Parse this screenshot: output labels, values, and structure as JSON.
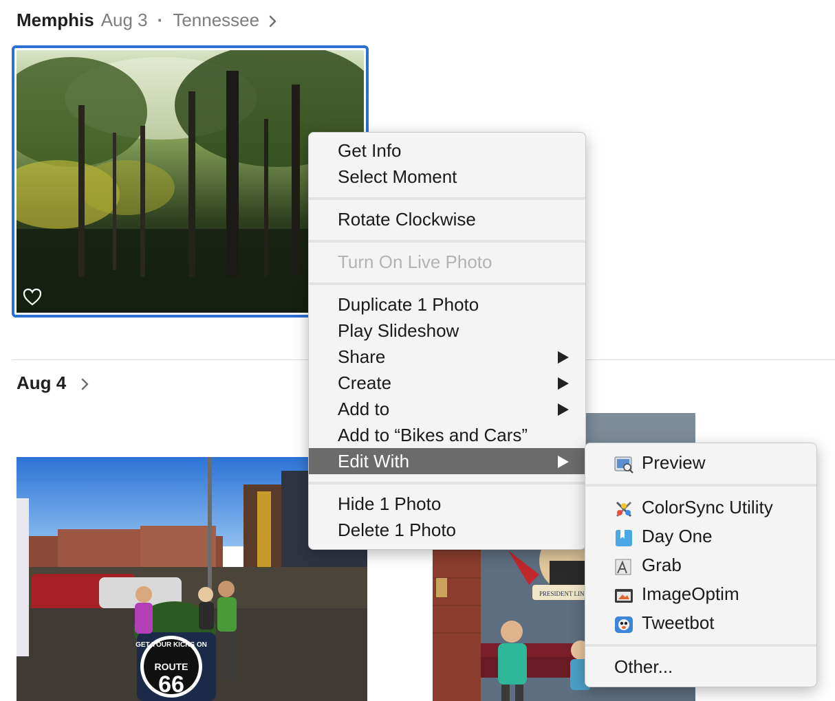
{
  "moment1": {
    "title": "Memphis",
    "date": "Aug 3",
    "separator": "·",
    "location": "Tennessee"
  },
  "moment2": {
    "date": "Aug 4"
  },
  "context_menu": {
    "items": [
      {
        "label": "Get Info"
      },
      {
        "label": "Select Moment"
      },
      {
        "label": "Rotate Clockwise"
      },
      {
        "label": "Turn On Live Photo",
        "disabled": true
      },
      {
        "label": "Duplicate 1 Photo"
      },
      {
        "label": "Play Slideshow"
      },
      {
        "label": "Share",
        "submenu": true
      },
      {
        "label": "Create",
        "submenu": true
      },
      {
        "label": "Add to",
        "submenu": true
      },
      {
        "label": "Add to “Bikes and Cars”"
      },
      {
        "label": "Edit With",
        "submenu": true,
        "highlighted": true
      },
      {
        "label": "Hide 1 Photo"
      },
      {
        "label": "Delete 1 Photo"
      }
    ]
  },
  "edit_with_submenu": {
    "items": [
      {
        "label": "Preview",
        "icon": "preview-icon"
      },
      {
        "label": "ColorSync Utility",
        "icon": "colorsync-utility-icon"
      },
      {
        "label": "Day One",
        "icon": "day-one-icon"
      },
      {
        "label": "Grab",
        "icon": "grab-icon"
      },
      {
        "label": "ImageOptim",
        "icon": "imageoptim-icon"
      },
      {
        "label": "Tweetbot",
        "icon": "tweetbot-icon"
      },
      {
        "label": "Other..."
      }
    ]
  },
  "photo3_sign": {
    "line1": "GET YOUR KICKS ON",
    "line2": "ROUTE",
    "line3": "66"
  },
  "photo4_sign": {
    "text": "PRESIDENT LINCOLN"
  },
  "colors": {
    "selection": "#2b6fd1",
    "menu_bg": "#f4f4f4",
    "menu_highlight": "#6b6b6b",
    "disabled_text": "#b3b3b3",
    "header_gray": "#7d7d7d"
  }
}
